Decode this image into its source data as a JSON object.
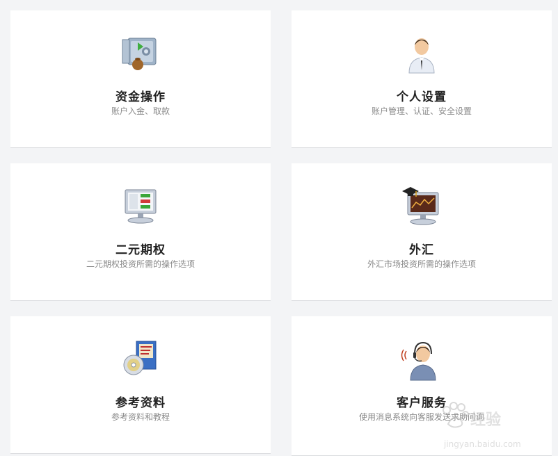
{
  "cards": [
    {
      "title": "资金操作",
      "subtitle": "账户入金、取款",
      "icon": "safe-icon"
    },
    {
      "title": "个人设置",
      "subtitle": "账户管理、认证、安全设置",
      "icon": "user-profile-icon"
    },
    {
      "title": "二元期权",
      "subtitle": "二元期权投资所需的操作选项",
      "icon": "computer-trading-icon"
    },
    {
      "title": "外汇",
      "subtitle": "外汇市场投资所需的操作选项",
      "icon": "computer-graduation-cap-icon"
    },
    {
      "title": "参考资料",
      "subtitle": "参考资料和教程",
      "icon": "book-cd-icon"
    },
    {
      "title": "客户服务",
      "subtitle": "使用消息系统向客服发送求助问询",
      "icon": "support-headset-icon"
    }
  ],
  "watermark": {
    "text": "经验",
    "url": "jingyan.baidu.com"
  },
  "colors": {
    "background": "#f3f4f6",
    "card": "#ffffff",
    "title": "#222222",
    "subtitle": "#8a8a8a"
  }
}
